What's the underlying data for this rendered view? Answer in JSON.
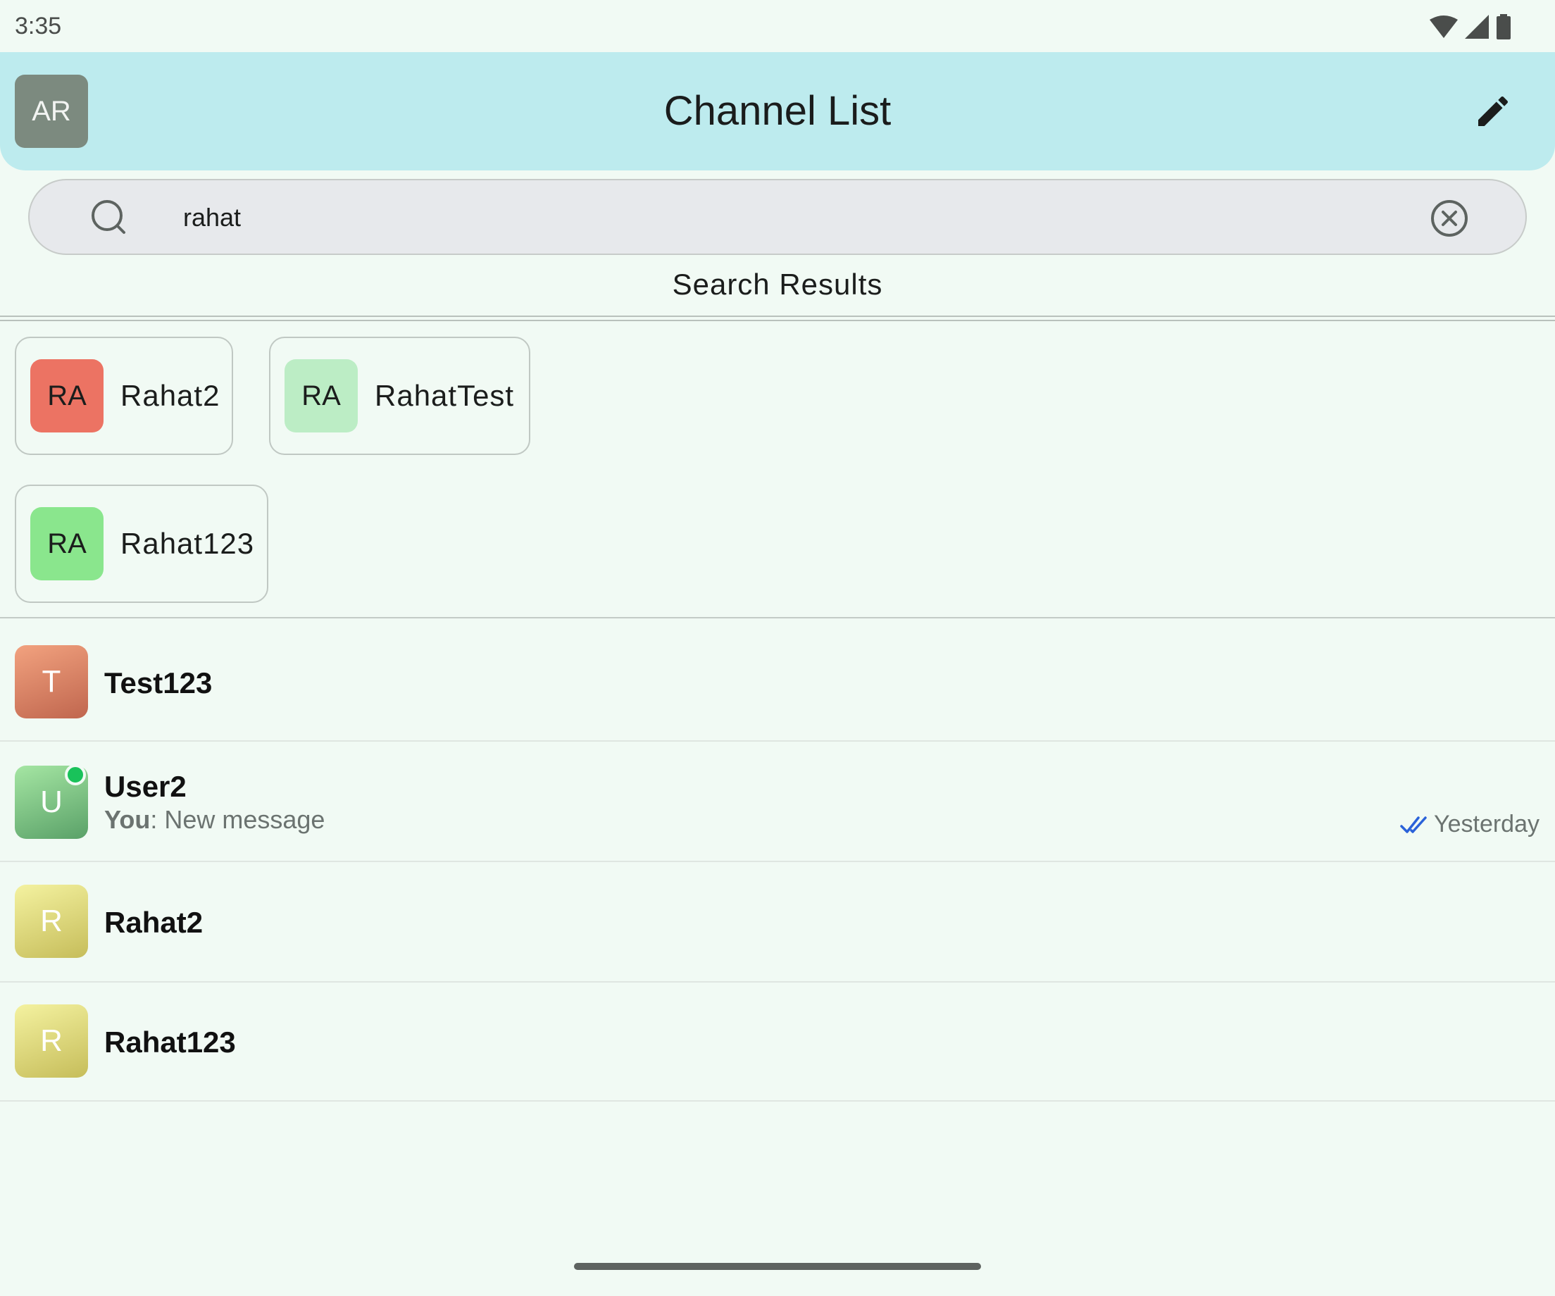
{
  "status_bar": {
    "time": "3:35"
  },
  "header": {
    "avatar_initials": "AR",
    "title": "Channel List"
  },
  "search": {
    "value": "rahat",
    "placeholder": ""
  },
  "search_results": {
    "label": "Search Results",
    "chips": [
      {
        "initials": "RA",
        "name": "Rahat2",
        "color": "#ec7363"
      },
      {
        "initials": "RA",
        "name": "RahatTest",
        "color": "#bcedc5"
      },
      {
        "initials": "RA",
        "name": "Rahat123",
        "color": "#8ae68d"
      }
    ]
  },
  "channels": [
    {
      "initial": "T",
      "name": "Test123",
      "preview_prefix": "",
      "preview": "",
      "time": "",
      "colors": [
        "#f2a27f",
        "#c0664e"
      ]
    },
    {
      "initial": "U",
      "name": "User2",
      "preview_prefix": "You",
      "preview": ": New message",
      "time": "Yesterday",
      "online": true,
      "colors": [
        "#a5e6a3",
        "#5aa168"
      ]
    },
    {
      "initial": "R",
      "name": "Rahat2",
      "preview_prefix": "",
      "preview": "",
      "time": "",
      "colors": [
        "#f4f2a0",
        "#c6bd5a"
      ]
    },
    {
      "initial": "R",
      "name": "Rahat123",
      "preview_prefix": "",
      "preview": "",
      "time": "",
      "colors": [
        "#f4f2a0",
        "#c6bd5a"
      ]
    }
  ],
  "colors": {
    "header_bg": "#bdebee",
    "screen_bg": "#f1faf4",
    "read_check": "#2b62d9",
    "online": "#19c25a"
  }
}
